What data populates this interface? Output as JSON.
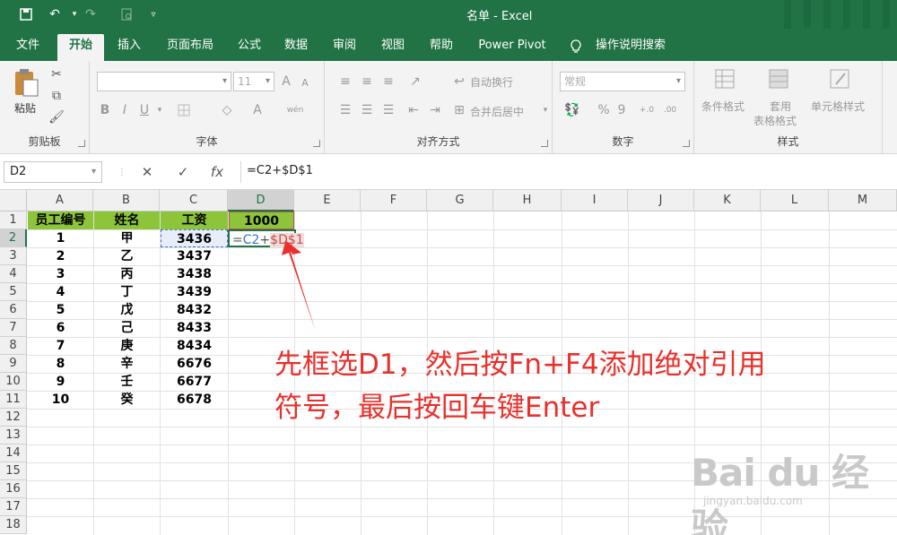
{
  "window": {
    "title": "名单  -  Excel"
  },
  "quick_access": {
    "icons": [
      "save-icon",
      "undo-icon",
      "redo-icon",
      "print-preview-icon",
      "customize-icon"
    ]
  },
  "ribbon": {
    "tabs": [
      "文件",
      "开始",
      "插入",
      "页面布局",
      "公式",
      "数据",
      "审阅",
      "视图",
      "帮助",
      "Power Pivot",
      "操作说明搜索"
    ],
    "active_tab": "开始",
    "groups": {
      "clipboard": {
        "label": "剪贴板",
        "paste_label": "粘贴"
      },
      "font": {
        "label": "字体",
        "font_size": "11",
        "bold": "B",
        "italic": "I",
        "underline": "U",
        "grow": "A",
        "shrink": "A",
        "font_color": "A",
        "phonetic": "wén"
      },
      "alignment": {
        "label": "对齐方式",
        "wrap_text": "自动换行",
        "merge_center": "合并后居中"
      },
      "number": {
        "label": "数字",
        "format": "常规",
        "percent": "%",
        "comma": "9"
      },
      "styles": {
        "label": "样式",
        "conditional": "条件格式",
        "table_format_1": "套用",
        "table_format_2": "表格格式",
        "cell_styles": "单元格样式"
      }
    }
  },
  "formula_bar": {
    "name_box": "D2",
    "cancel": "✕",
    "enter": "✓",
    "fx": "fx",
    "formula": "=C2+$D$1"
  },
  "sheet": {
    "columns": [
      "A",
      "B",
      "C",
      "D",
      "E",
      "F",
      "G",
      "H",
      "I",
      "J",
      "K",
      "L",
      "M"
    ],
    "rows": [
      "1",
      "2",
      "3",
      "4",
      "5",
      "6",
      "7",
      "8",
      "9",
      "10",
      "11",
      "12",
      "13",
      "14",
      "15",
      "16",
      "17",
      "18"
    ],
    "header": [
      "员工编号",
      "姓名",
      "工资",
      "1000"
    ],
    "data": [
      [
        "1",
        "甲",
        "3436"
      ],
      [
        "2",
        "乙",
        "3437"
      ],
      [
        "3",
        "丙",
        "3438"
      ],
      [
        "4",
        "丁",
        "3439"
      ],
      [
        "5",
        "戊",
        "8432"
      ],
      [
        "6",
        "己",
        "8433"
      ],
      [
        "7",
        "庚",
        "8434"
      ],
      [
        "8",
        "辛",
        "6676"
      ],
      [
        "9",
        "壬",
        "6677"
      ],
      [
        "10",
        "癸",
        "6678"
      ]
    ],
    "active_cell": "D2",
    "edit_tokens": {
      "eq": "=",
      "ref": "C2",
      "plus": "+",
      "abs": "$D$1"
    }
  },
  "annotation": {
    "line1": "先框选D1，然后按Fn+F4添加绝对引用",
    "line2": "符号，最后按回车键Enter"
  },
  "watermark": {
    "brand": "Bai du 经验",
    "url": "jingyan.baidu.com"
  },
  "colors": {
    "excel_green": "#217346",
    "header_fill": "#8cc43a",
    "annotation": "#e8302c",
    "ref_blue": "#4472c4",
    "ref_red": "#c0504d"
  }
}
